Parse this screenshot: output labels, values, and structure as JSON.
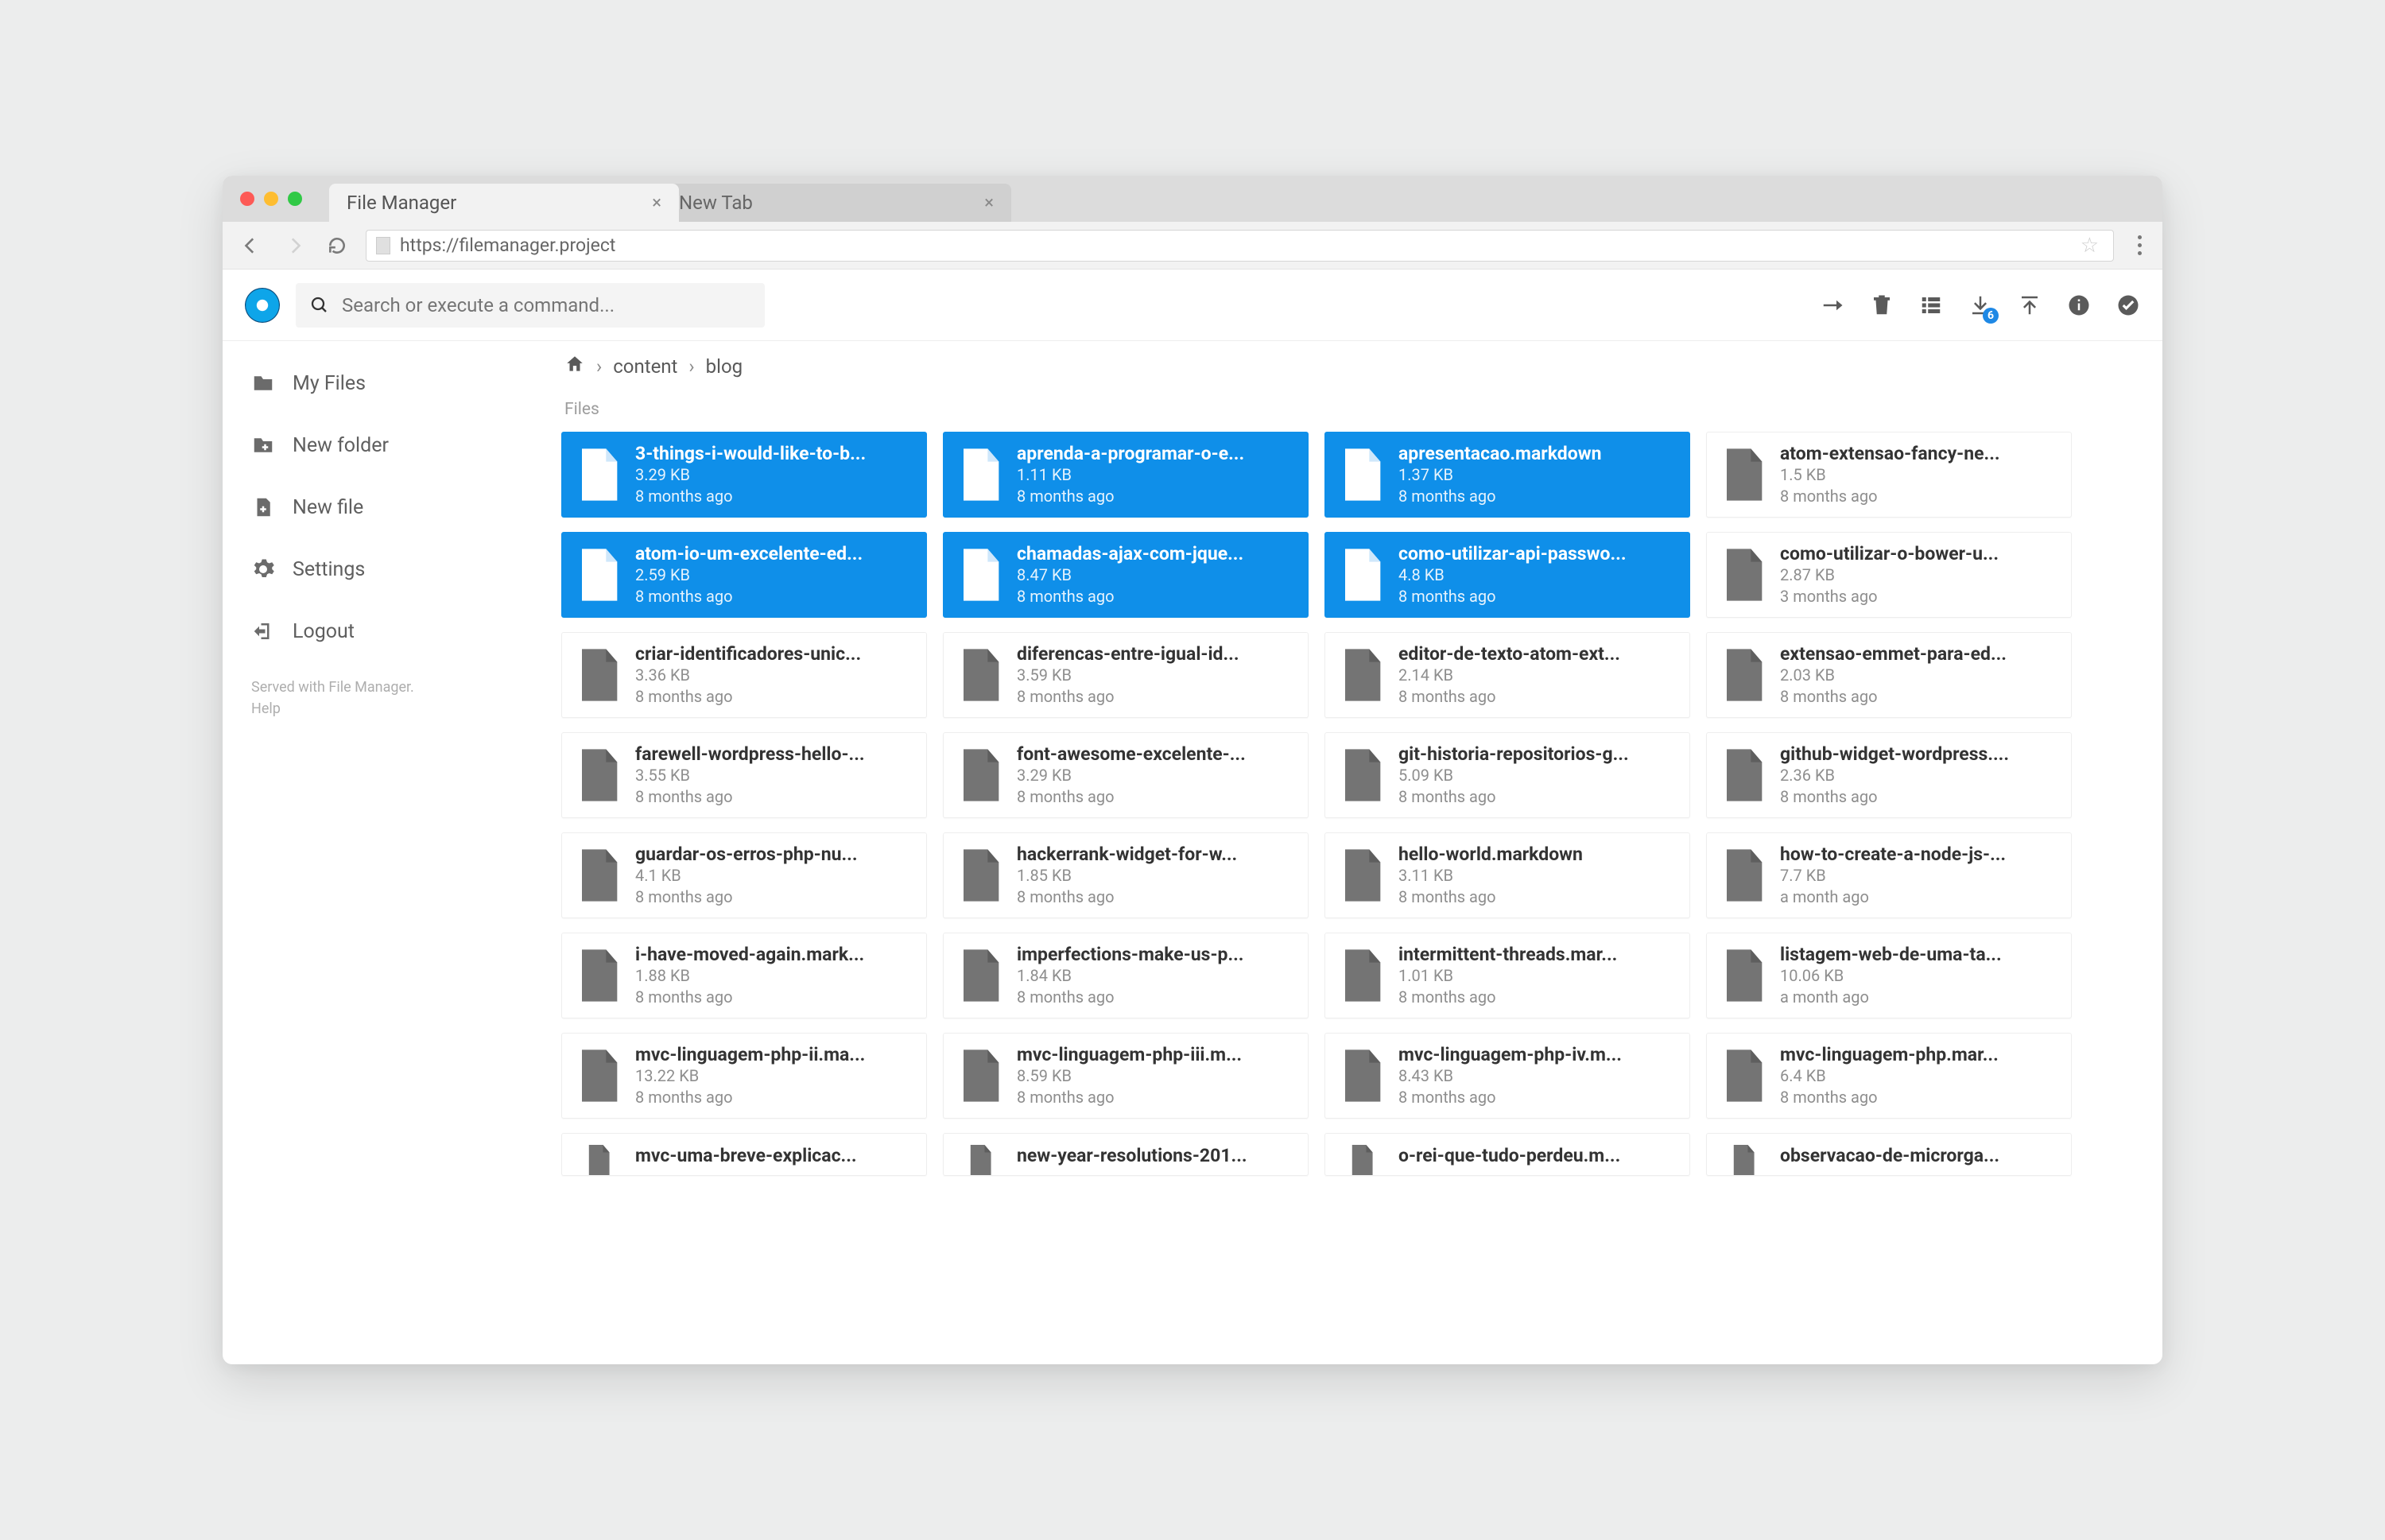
{
  "browser": {
    "tabs": [
      {
        "label": "File Manager",
        "active": true
      },
      {
        "label": "New Tab",
        "active": false
      }
    ],
    "url": "https://filemanager.project"
  },
  "search": {
    "placeholder": "Search or execute a command..."
  },
  "toolbar": {
    "download_badge": "6"
  },
  "sidebar": {
    "items": [
      {
        "icon": "folder",
        "label": "My Files"
      },
      {
        "icon": "new-folder",
        "label": "New folder"
      },
      {
        "icon": "new-file",
        "label": "New file"
      },
      {
        "icon": "settings",
        "label": "Settings"
      },
      {
        "icon": "logout",
        "label": "Logout"
      }
    ],
    "footer1": "Served with File Manager.",
    "footer2": "Help"
  },
  "breadcrumbs": [
    "content",
    "blog"
  ],
  "section_label": "Files",
  "files": [
    {
      "name": "3-things-i-would-like-to-b...",
      "size": "3.29 KB",
      "time": "8 months ago",
      "selected": true
    },
    {
      "name": "aprenda-a-programar-o-e...",
      "size": "1.11 KB",
      "time": "8 months ago",
      "selected": true
    },
    {
      "name": "apresentacao.markdown",
      "size": "1.37 KB",
      "time": "8 months ago",
      "selected": true
    },
    {
      "name": "atom-extensao-fancy-ne...",
      "size": "1.5 KB",
      "time": "8 months ago",
      "selected": false
    },
    {
      "name": "atom-io-um-excelente-ed...",
      "size": "2.59 KB",
      "time": "8 months ago",
      "selected": true
    },
    {
      "name": "chamadas-ajax-com-jque...",
      "size": "8.47 KB",
      "time": "8 months ago",
      "selected": true
    },
    {
      "name": "como-utilizar-api-passwo...",
      "size": "4.8 KB",
      "time": "8 months ago",
      "selected": true
    },
    {
      "name": "como-utilizar-o-bower-u...",
      "size": "2.87 KB",
      "time": "3 months ago",
      "selected": false
    },
    {
      "name": "criar-identificadores-unic...",
      "size": "3.36 KB",
      "time": "8 months ago",
      "selected": false
    },
    {
      "name": "diferencas-entre-igual-id...",
      "size": "3.59 KB",
      "time": "8 months ago",
      "selected": false
    },
    {
      "name": "editor-de-texto-atom-ext...",
      "size": "2.14 KB",
      "time": "8 months ago",
      "selected": false
    },
    {
      "name": "extensao-emmet-para-ed...",
      "size": "2.03 KB",
      "time": "8 months ago",
      "selected": false
    },
    {
      "name": "farewell-wordpress-hello-...",
      "size": "3.55 KB",
      "time": "8 months ago",
      "selected": false
    },
    {
      "name": "font-awesome-excelente-...",
      "size": "3.29 KB",
      "time": "8 months ago",
      "selected": false
    },
    {
      "name": "git-historia-repositorios-g...",
      "size": "5.09 KB",
      "time": "8 months ago",
      "selected": false
    },
    {
      "name": "github-widget-wordpress....",
      "size": "2.36 KB",
      "time": "8 months ago",
      "selected": false
    },
    {
      "name": "guardar-os-erros-php-nu...",
      "size": "4.1 KB",
      "time": "8 months ago",
      "selected": false
    },
    {
      "name": "hackerrank-widget-for-w...",
      "size": "1.85 KB",
      "time": "8 months ago",
      "selected": false
    },
    {
      "name": "hello-world.markdown",
      "size": "3.11 KB",
      "time": "8 months ago",
      "selected": false
    },
    {
      "name": "how-to-create-a-node-js-...",
      "size": "7.7 KB",
      "time": "a month ago",
      "selected": false
    },
    {
      "name": "i-have-moved-again.mark...",
      "size": "1.88 KB",
      "time": "8 months ago",
      "selected": false
    },
    {
      "name": "imperfections-make-us-p...",
      "size": "1.84 KB",
      "time": "8 months ago",
      "selected": false
    },
    {
      "name": "intermittent-threads.mar...",
      "size": "1.01 KB",
      "time": "8 months ago",
      "selected": false
    },
    {
      "name": "listagem-web-de-uma-ta...",
      "size": "10.06 KB",
      "time": "a month ago",
      "selected": false
    },
    {
      "name": "mvc-linguagem-php-ii.ma...",
      "size": "13.22 KB",
      "time": "8 months ago",
      "selected": false
    },
    {
      "name": "mvc-linguagem-php-iii.m...",
      "size": "8.59 KB",
      "time": "8 months ago",
      "selected": false
    },
    {
      "name": "mvc-linguagem-php-iv.m...",
      "size": "8.43 KB",
      "time": "8 months ago",
      "selected": false
    },
    {
      "name": "mvc-linguagem-php.mar...",
      "size": "6.4 KB",
      "time": "8 months ago",
      "selected": false
    },
    {
      "name": "mvc-uma-breve-explicac...",
      "size": "",
      "time": "",
      "selected": false,
      "partial": true
    },
    {
      "name": "new-year-resolutions-201...",
      "size": "",
      "time": "",
      "selected": false,
      "partial": true
    },
    {
      "name": "o-rei-que-tudo-perdeu.m...",
      "size": "",
      "time": "",
      "selected": false,
      "partial": true
    },
    {
      "name": "observacao-de-microrga...",
      "size": "",
      "time": "",
      "selected": false,
      "partial": true
    }
  ]
}
